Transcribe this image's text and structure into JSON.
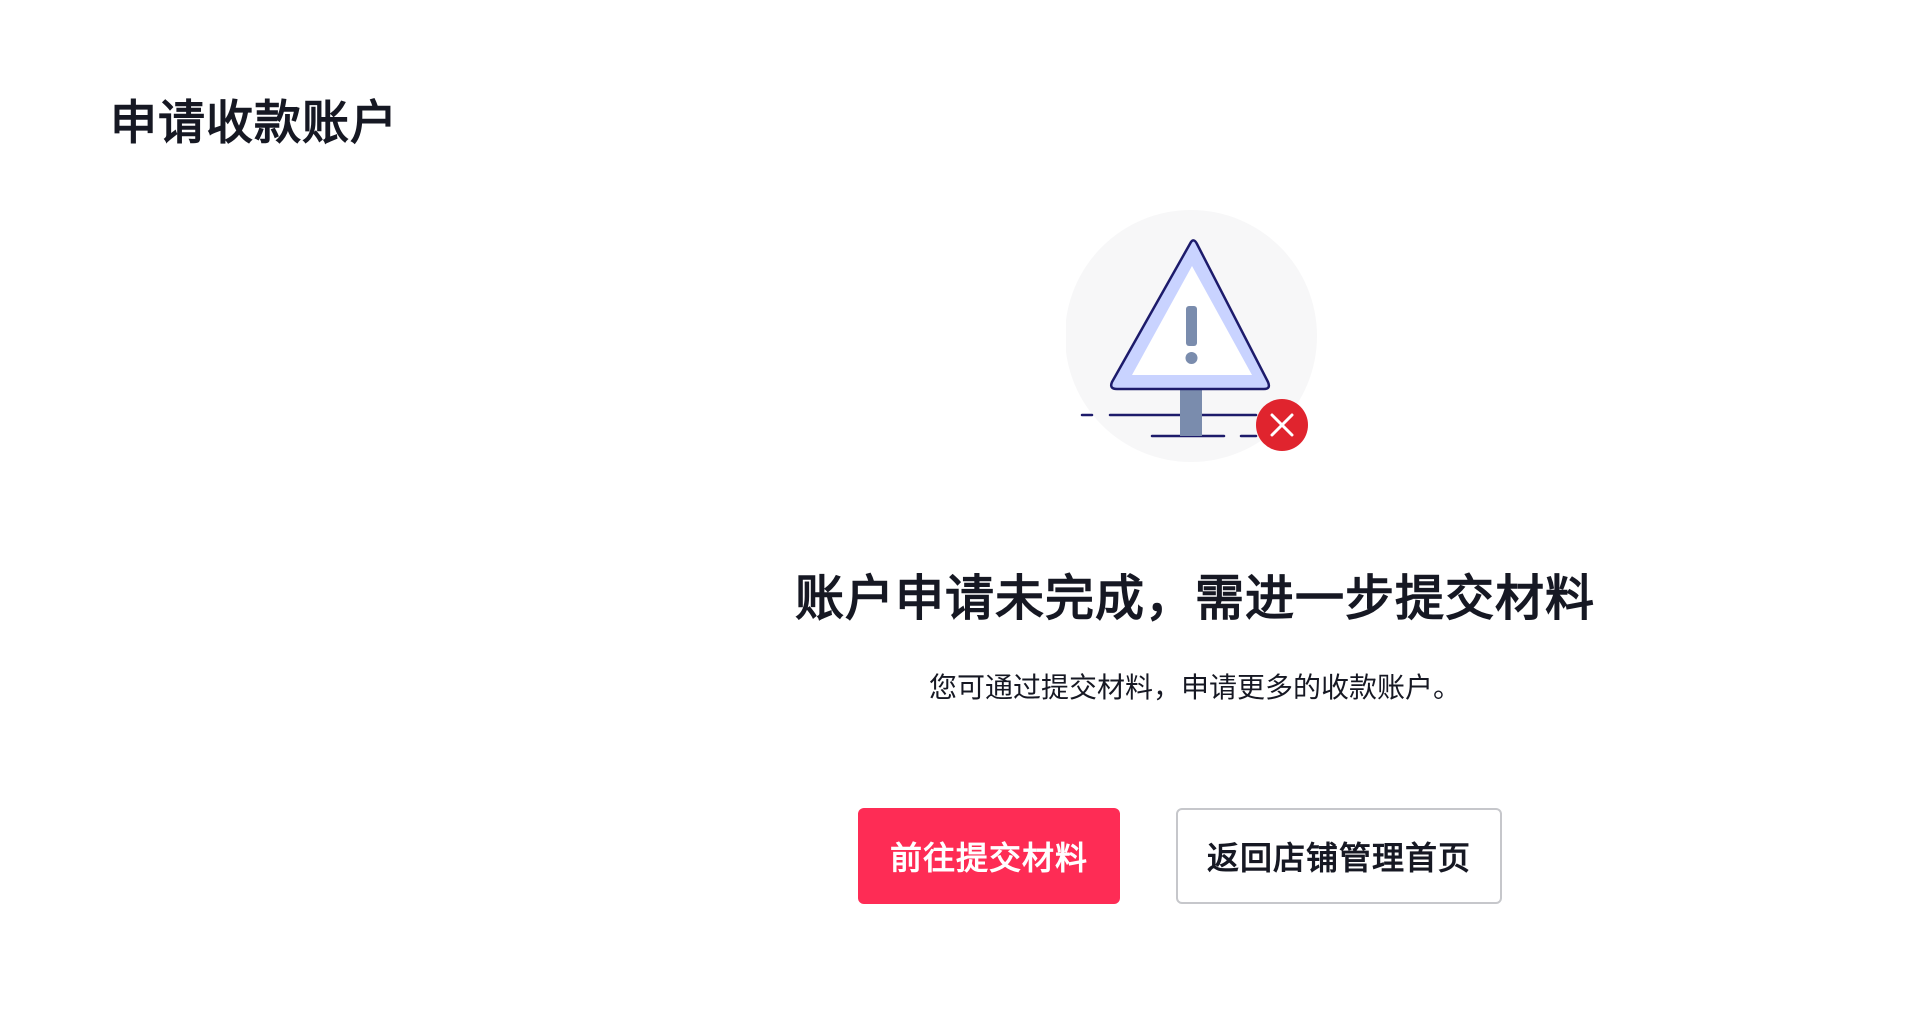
{
  "page": {
    "title": "申请收款账户"
  },
  "result": {
    "icon": "warning-sign-icon",
    "status_icon": "error-close-icon",
    "title": "账户申请未完成，需进一步提交材料",
    "description": "您可通过提交材料，申请更多的收款账户。"
  },
  "actions": {
    "primary_label": "前往提交材料",
    "secondary_label": "返回店铺管理首页"
  },
  "colors": {
    "accent": "#fe2c55",
    "error": "#e0242e",
    "warning_fill": "#c9d3ff",
    "text": "#161823"
  }
}
